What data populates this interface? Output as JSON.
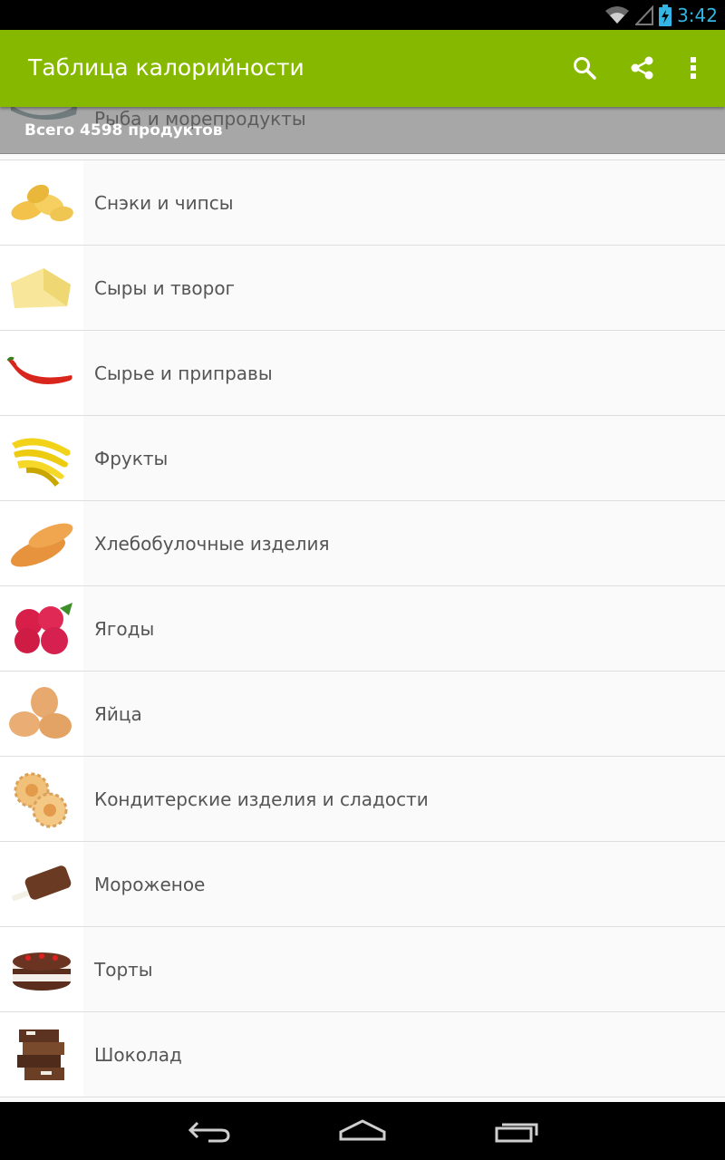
{
  "status_bar": {
    "time": "3:42",
    "accent_color": "#33b5e5",
    "icons": [
      "wifi-icon",
      "signal-icon",
      "battery-charging-icon"
    ]
  },
  "action_bar": {
    "title": "Таблица калорийности",
    "background": "#86b800",
    "actions": [
      "search-icon",
      "share-icon",
      "overflow-menu-icon"
    ]
  },
  "header": {
    "category": "Рыба и морепродукты",
    "total": "Всего 4598 продуктов"
  },
  "categories": [
    {
      "label": "Снэки и чипсы",
      "icon": "chips-icon"
    },
    {
      "label": "Сыры и творог",
      "icon": "cheese-icon"
    },
    {
      "label": "Сырье и приправы",
      "icon": "chili-pepper-icon"
    },
    {
      "label": "Фрукты",
      "icon": "banana-icon"
    },
    {
      "label": "Хлебобулочные изделия",
      "icon": "bread-icon"
    },
    {
      "label": "Ягоды",
      "icon": "raspberry-icon"
    },
    {
      "label": "Яйца",
      "icon": "eggs-icon"
    },
    {
      "label": "Кондитерские изделия и сладости",
      "icon": "cookies-icon"
    },
    {
      "label": "Мороженое",
      "icon": "ice-cream-icon"
    },
    {
      "label": "Торты",
      "icon": "cake-icon"
    },
    {
      "label": "Шоколад",
      "icon": "chocolate-icon"
    }
  ],
  "nav_bar": {
    "buttons": [
      "back-icon",
      "home-icon",
      "recents-icon"
    ]
  }
}
